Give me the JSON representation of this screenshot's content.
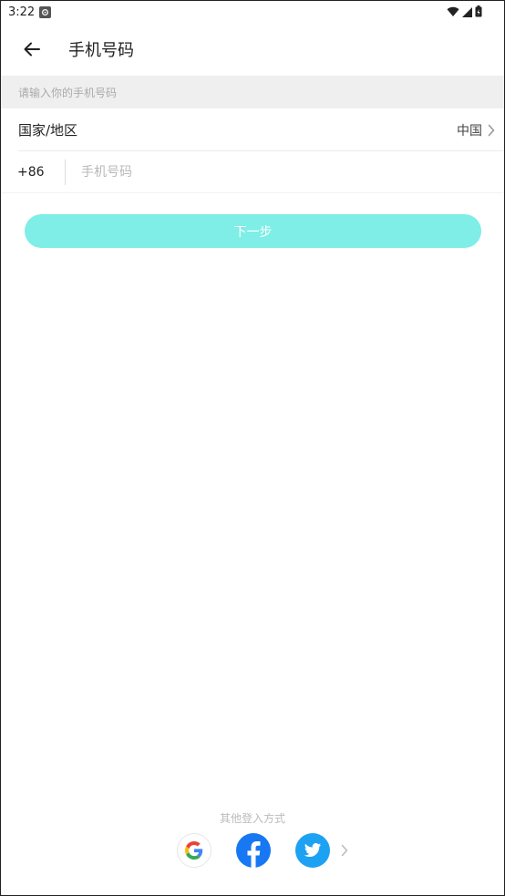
{
  "status_bar": {
    "time": "3:22"
  },
  "header": {
    "title": "手机号码"
  },
  "hint": {
    "text": "请输入你的手机号码"
  },
  "country": {
    "label": "国家/地区",
    "value": "中国"
  },
  "phone": {
    "prefix": "+86",
    "placeholder": "手机号码",
    "value": ""
  },
  "next_button": {
    "label": "下一步"
  },
  "other_login": {
    "title": "其他登入方式"
  },
  "colors": {
    "accent": "#7eeee6",
    "facebook": "#1877f2",
    "twitter": "#1da1f2",
    "hint_bg": "#efefef"
  },
  "icons": {
    "status_left": "app-notification-icon",
    "status_right": [
      "wifi-icon",
      "signal-icon",
      "battery-icon"
    ],
    "back": "arrow-left-icon",
    "country_chevron": "chevron-right-icon",
    "social": [
      "google-icon",
      "facebook-icon",
      "twitter-icon"
    ],
    "more": "chevron-right-icon"
  }
}
